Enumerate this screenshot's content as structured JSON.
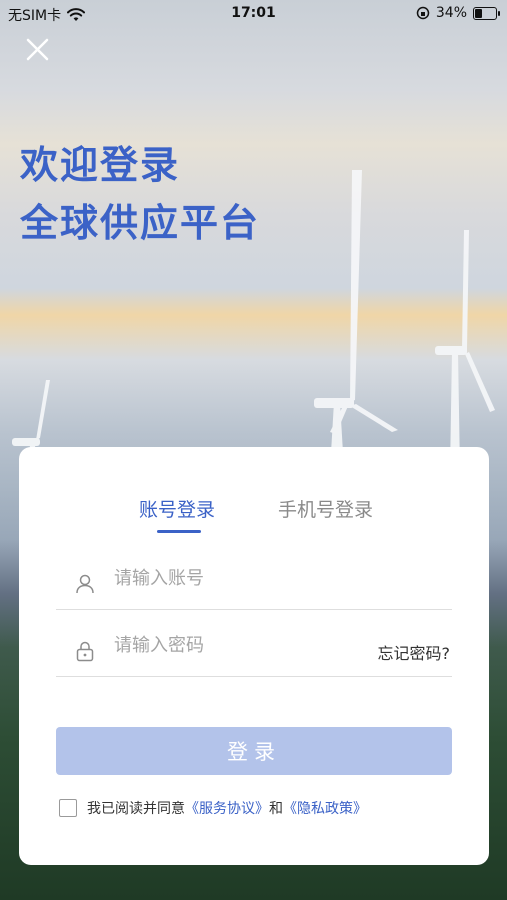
{
  "status_bar": {
    "carrier": "无SIM卡",
    "time": "17:01",
    "battery": "34%",
    "icons": [
      "wifi-icon",
      "orientation-lock-icon",
      "battery-icon"
    ]
  },
  "header": {
    "title_line1": "欢迎登录",
    "title_line2": "全球供应平台"
  },
  "tabs": [
    {
      "label": "账号登录",
      "active": true
    },
    {
      "label": "手机号登录",
      "active": false
    }
  ],
  "form": {
    "account_placeholder": "请输入账号",
    "password_placeholder": "请输入密码",
    "forgot_password": "忘记密码?",
    "login_button": "登录"
  },
  "agreement": {
    "prefix": "我已阅读并同意",
    "service": "《服务协议》",
    "and": "和",
    "privacy": "《隐私政策》"
  },
  "colors": {
    "accent": "#3b62c7",
    "button_disabled": "#b3c3ea"
  }
}
